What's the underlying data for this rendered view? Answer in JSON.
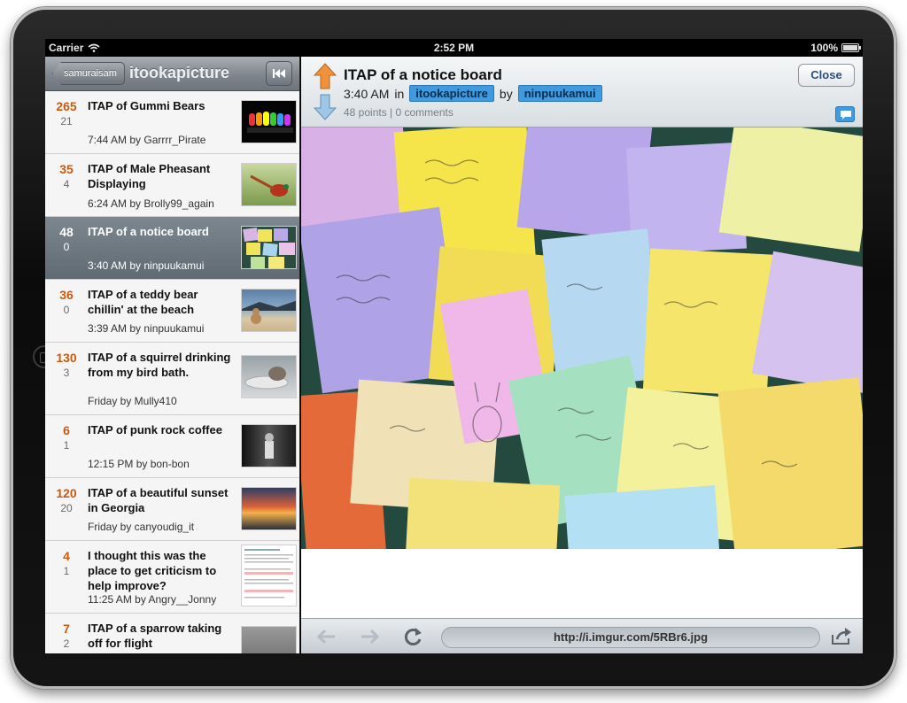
{
  "status_bar": {
    "carrier": "Carrier",
    "time": "2:52 PM",
    "battery": "100%"
  },
  "list_pane": {
    "back_label": "samuraisam",
    "title": "itookapicture",
    "stories": [
      {
        "score": "265",
        "comments": "21",
        "title": "ITAP of Gummi Bears",
        "meta": "7:44 AM by Garrrr_Pirate"
      },
      {
        "score": "35",
        "comments": "4",
        "title": "ITAP of Male Pheasant Displaying",
        "meta": "6:24 AM by Brolly99_again"
      },
      {
        "score": "48",
        "comments": "0",
        "title": "ITAP of a notice board",
        "meta": "3:40 AM by ninpuukamui",
        "selected": true
      },
      {
        "score": "36",
        "comments": "0",
        "title": "ITAP of a teddy bear chillin' at the beach",
        "meta": "3:39 AM by ninpuukamui"
      },
      {
        "score": "130",
        "comments": "3",
        "title": "ITAP of a squirrel drinking from my bird bath.",
        "meta": "Friday by Mully410"
      },
      {
        "score": "6",
        "comments": "1",
        "title": "ITAP of punk rock coffee",
        "meta": "12:15 PM by bon-bon"
      },
      {
        "score": "120",
        "comments": "20",
        "title": "ITAP of a beautiful sunset in Georgia",
        "meta": "Friday by canyoudig_it"
      },
      {
        "score": "4",
        "comments": "1",
        "title": "I thought this was the place to get criticism to help improve?",
        "meta": "11:25 AM by Angry__Jonny"
      },
      {
        "score": "7",
        "comments": "2",
        "title": "ITAP of a sparrow taking off for flight",
        "meta": ""
      }
    ]
  },
  "detail": {
    "title": "ITAP of a notice board",
    "time": "3:40 AM",
    "in_word": "in",
    "subreddit": "itookapicture",
    "by_word": "by",
    "author": "ninpuukamui",
    "stats": "48 points | 0 comments",
    "close_label": "Close"
  },
  "browser": {
    "url": "http://i.imgur.com/5RBr6.jpg"
  },
  "colors": {
    "accent": "#3f9adf",
    "score": "#c55b10",
    "upvote": "#f0923c",
    "downvote": "#7fb3dd"
  },
  "icons": [
    "wifi-icon",
    "battery-icon",
    "rewind-icon",
    "upvote-arrow-icon",
    "downvote-arrow-icon",
    "comment-bubble-icon",
    "back-arrow-icon",
    "forward-arrow-icon",
    "reload-icon",
    "share-icon",
    "home-button-icon"
  ]
}
